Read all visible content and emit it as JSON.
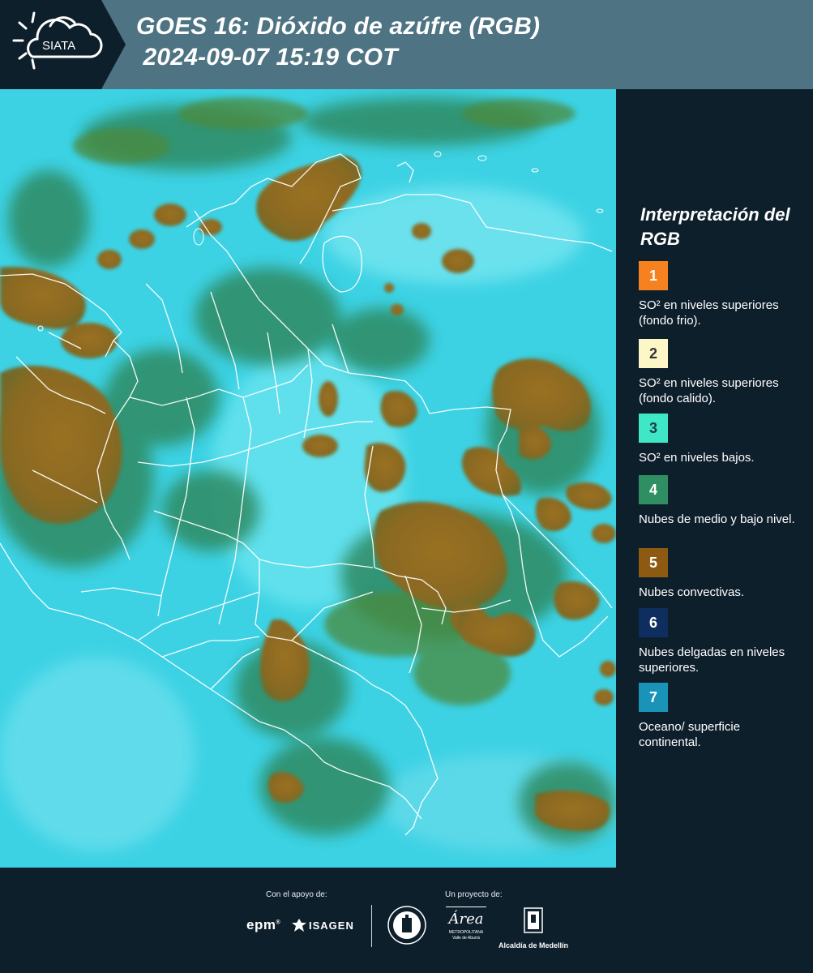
{
  "header": {
    "logo_text": "SIATA",
    "title_line1": "GOES 16: Dióxido de azúfre (RGB)",
    "title_line2": " 2024-09-07 15:19 COT"
  },
  "legend": {
    "title": "Interpretación del RGB",
    "items": [
      {
        "number": "1",
        "color": "#f5821f",
        "text_color": "#ffffff",
        "label": "SO² en niveles superiores (fondo frio)."
      },
      {
        "number": "2",
        "color": "#fdf6c6",
        "text_color": "#333333",
        "label": "SO² en niveles superiores (fondo calido)."
      },
      {
        "number": "3",
        "color": "#3ee8c6",
        "text_color": "#1c3b44",
        "label": "SO² en niveles bajos."
      },
      {
        "number": "4",
        "color": "#2f8f63",
        "text_color": "#ffffff",
        "label": "Nubes de medio y bajo nivel."
      },
      {
        "number": "5",
        "color": "#8e5a12",
        "text_color": "#ffffff",
        "label": "Nubes convectivas."
      },
      {
        "number": "6",
        "color": "#0d2e5e",
        "text_color": "#ffffff",
        "label": "Nubes delgadas en niveles superiores."
      },
      {
        "number": "7",
        "color": "#1a93b8",
        "text_color": "#ffffff",
        "label": "Oceano/ superficie continental."
      }
    ]
  },
  "footer": {
    "support_label": "Con el apoyo de:",
    "project_label": "Un proyecto de:",
    "epm_text": "epm",
    "isagen_text": "ISAGEN",
    "area_text": "Área",
    "area_sub": "METROPOLITANA",
    "area_sub2": "Valle de Aburrá",
    "alcaldia_text": "Alcaldía de Medellín"
  },
  "colors": {
    "header_bg": "#4e7383",
    "panel_bg": "#0e1f2c",
    "sea_cyan": "#35d3e6",
    "cloud_brown": "#8e6a1f",
    "border_white": "#ffffff"
  }
}
